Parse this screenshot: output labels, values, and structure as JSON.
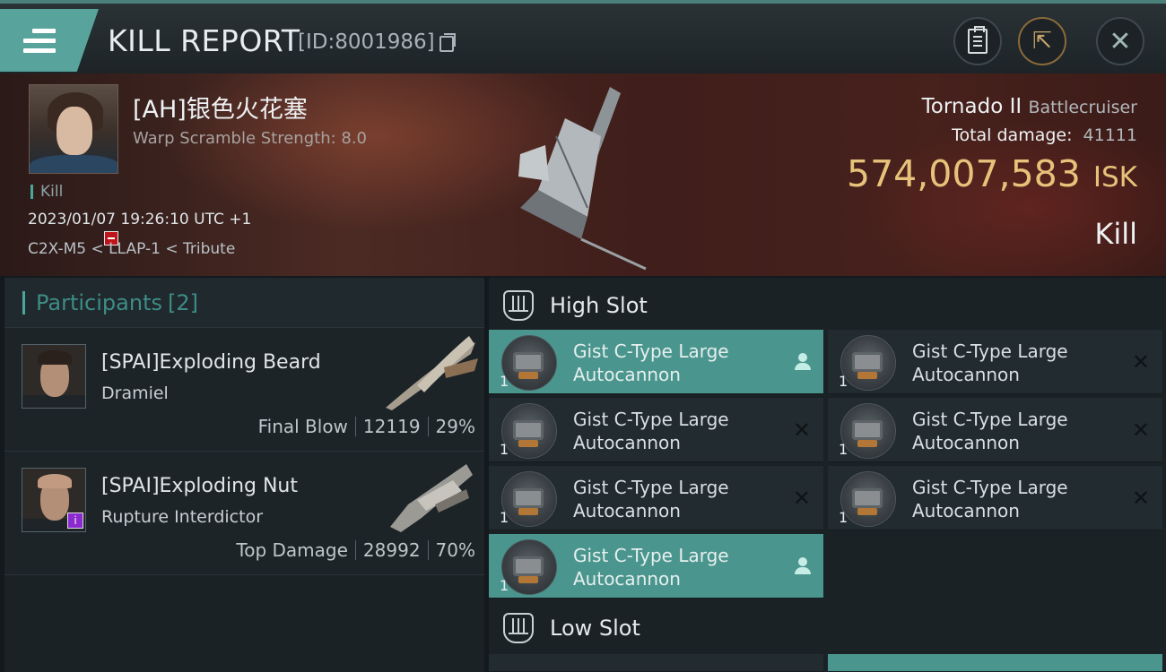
{
  "header": {
    "title": "KILL REPORT",
    "report_id": "[ID:8001986]"
  },
  "victim": {
    "name": "[AH]银色火花塞",
    "warp_scramble": "Warp Scramble Strength: 8.0",
    "result_tag": "Kill",
    "datetime": "2023/01/07 19:26:10 UTC +1",
    "location": "C2X-M5 < LLAP-1 < Tribute"
  },
  "ship": {
    "name": "Tornado II",
    "class": "Battlecruiser",
    "total_damage_label": "Total damage:",
    "total_damage_value": "41111",
    "isk_value": "574,007,583",
    "isk_unit": "ISK",
    "outcome": "Kill"
  },
  "participants": {
    "header": "Participants",
    "count": "[2]",
    "list": [
      {
        "name": "[SPAI]Exploding Beard",
        "ship": "Dramiel",
        "role": "Final Blow",
        "damage": "12119",
        "percent": "29%"
      },
      {
        "name": "[SPAI]Exploding Nut",
        "ship": "Rupture Interdictor",
        "role": "Top Damage",
        "damage": "28992",
        "percent": "70%"
      }
    ]
  },
  "fitting": {
    "high_slot_label": "High Slot",
    "low_slot_label": "Low Slot",
    "high_slot_items": [
      {
        "name": "Gist C-Type Large Autocannon",
        "qty": "1",
        "status": "highlighted"
      },
      {
        "name": "Gist C-Type Large Autocannon",
        "qty": "1",
        "status": "destroyed"
      },
      {
        "name": "Gist C-Type Large Autocannon",
        "qty": "1",
        "status": "destroyed"
      },
      {
        "name": "Gist C-Type Large Autocannon",
        "qty": "1",
        "status": "destroyed"
      },
      {
        "name": "Gist C-Type Large Autocannon",
        "qty": "1",
        "status": "destroyed"
      },
      {
        "name": "Gist C-Type Large Autocannon",
        "qty": "1",
        "status": "destroyed"
      },
      {
        "name": "Gist C-Type Large Autocannon",
        "qty": "1",
        "status": "highlighted"
      }
    ]
  },
  "colors": {
    "accent_teal": "#4a968e",
    "isk_gold": "#e7c27a",
    "security_red": "#c0141b"
  }
}
